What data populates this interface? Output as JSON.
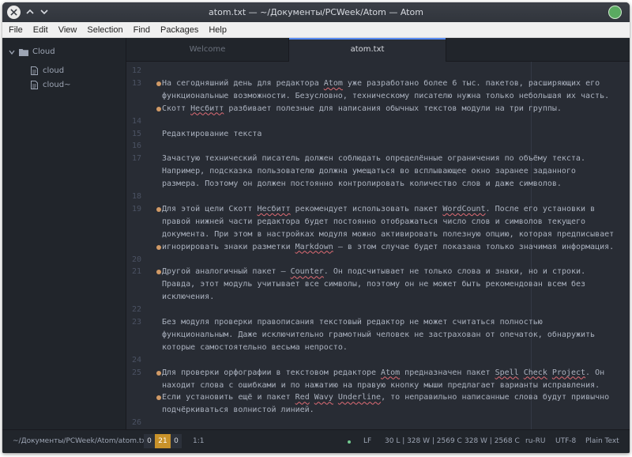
{
  "titlebar": {
    "title": "atom.txt — ~/Документы/PCWeek/Atom — Atom",
    "accent": "#5aaa61"
  },
  "menu": [
    "File",
    "Edit",
    "View",
    "Selection",
    "Find",
    "Packages",
    "Help"
  ],
  "tree": {
    "root": "Cloud",
    "files": [
      "cloud",
      "cloud~"
    ]
  },
  "tabs": {
    "welcome": "Welcome",
    "active": "atom.txt"
  },
  "editor": {
    "lines": [
      {
        "n": "12",
        "dot": false,
        "text": ""
      },
      {
        "n": "13",
        "dot": true,
        "text": "На сегодняшний день для редактора Atom уже разработано более 6 тыс. пакетов, расширяющих его"
      },
      {
        "n": "",
        "dot": false,
        "text": "функциональные возможности. Безусловно, техническому писателю нужна только небольшая их часть."
      },
      {
        "n": "",
        "dot": true,
        "text": "Скотт Несбитт разбивает полезные для написания обычных текстов модули на три группы."
      },
      {
        "n": "14",
        "dot": false,
        "text": ""
      },
      {
        "n": "15",
        "dot": false,
        "text": "Редактирование текста"
      },
      {
        "n": "16",
        "dot": false,
        "text": ""
      },
      {
        "n": "17",
        "dot": false,
        "text": "Зачастую технический писатель должен соблюдать определённые ограничения по объёму текста."
      },
      {
        "n": "",
        "dot": false,
        "text": "Например, подсказка пользователю должна умещаться во всплывающее окно заранее заданного"
      },
      {
        "n": "",
        "dot": false,
        "text": "размера. Поэтому он должен постоянно контролировать количество слов и даже символов."
      },
      {
        "n": "18",
        "dot": false,
        "text": ""
      },
      {
        "n": "19",
        "dot": true,
        "text": "Для этой цели Скотт Несбитт рекомендует использовать пакет WordCount. После его установки в"
      },
      {
        "n": "",
        "dot": false,
        "text": "правой нижней части редактора будет постоянно отображаться число слов и символов текущего"
      },
      {
        "n": "",
        "dot": false,
        "text": "документа. При этом в настройках модуля можно активировать полезную опцию, которая предписывает"
      },
      {
        "n": "",
        "dot": true,
        "text": "игнорировать знаки разметки Markdown — в этом случае будет показана только значимая информация."
      },
      {
        "n": "20",
        "dot": false,
        "text": ""
      },
      {
        "n": "21",
        "dot": true,
        "text": "Другой аналогичный пакет — Counter. Он подсчитывает не только слова и знаки, но и строки."
      },
      {
        "n": "",
        "dot": false,
        "text": "Правда, этот модуль учитывает все символы, поэтому он не может быть рекомендован всем без"
      },
      {
        "n": "",
        "dot": false,
        "text": "исключения."
      },
      {
        "n": "22",
        "dot": false,
        "text": ""
      },
      {
        "n": "23",
        "dot": false,
        "text": "Без модуля проверки правописания текстовый редактор не может считаться полностью"
      },
      {
        "n": "",
        "dot": false,
        "text": "функциональным. Даже исключительно грамотный человек не застрахован от опечаток, обнаружить"
      },
      {
        "n": "",
        "dot": false,
        "text": "которые самостоятельно весьма непросто."
      },
      {
        "n": "24",
        "dot": false,
        "text": ""
      },
      {
        "n": "25",
        "dot": true,
        "text": "Для проверки орфографии в текстовом редакторе Atom предназначен пакет Spell Check Project. Он"
      },
      {
        "n": "",
        "dot": false,
        "text": "находит слова с ошибками и по нажатию на правую кнопку мыши предлагает варианты исправления."
      },
      {
        "n": "",
        "dot": true,
        "text": "Если установить ещё и пакет Red Wavy Underline, то неправильно написанные слова будут привычно"
      },
      {
        "n": "",
        "dot": false,
        "text": "подчёркиваться волнистой линией."
      },
      {
        "n": "26",
        "dot": false,
        "text": ""
      }
    ],
    "misspelled_words": [
      "Atom",
      "Несбитт",
      "WordCount",
      "Markdown",
      "Counter",
      "Spell",
      "Check",
      "Project",
      "Red",
      "Wavy",
      "Underline"
    ]
  },
  "statusbar": {
    "path": "~/Документы/PCWeek/Atom/atom.txt",
    "counts": [
      "0",
      "21",
      "0"
    ],
    "cursor": "1:1",
    "line_ending": "LF",
    "stats_full": "30 L | 328 W | 2569 C",
    "stats_short": "328 W | 2568 C",
    "locale": "ru-RU",
    "encoding": "UTF-8",
    "grammar": "Plain Text"
  }
}
